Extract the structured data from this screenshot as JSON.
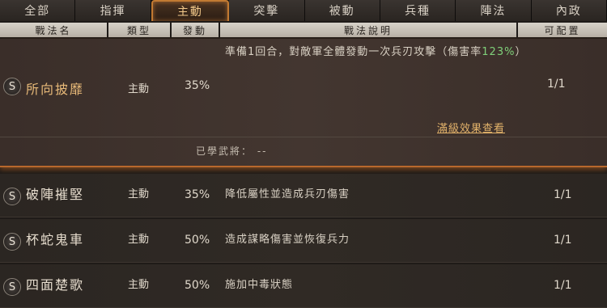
{
  "tabs": [
    "全部",
    "指揮",
    "主動",
    "突擊",
    "被動",
    "兵種",
    "陣法",
    "內政"
  ],
  "active_tab": "主動",
  "columns": [
    "戰法名",
    "類型",
    "發動",
    "戰法說明",
    "可配置"
  ],
  "expanded": {
    "badge": "S",
    "name": "所向披靡",
    "type": "主動",
    "rate": "35%",
    "desc_part1": "準備1回合，對敵軍全體發動一次兵刃攻擊（傷害率",
    "desc_pct": "123%",
    "desc_part2": "）",
    "capacity": "1/1",
    "link": "滿級效果查看",
    "learned_label": "已學武將：",
    "learned_value": "--"
  },
  "rows": [
    {
      "badge": "S",
      "name": "破陣摧堅",
      "type": "主動",
      "rate": "35%",
      "desc": "降低屬性並造成兵刃傷害",
      "capacity": "1/1"
    },
    {
      "badge": "S",
      "name": "杯蛇鬼車",
      "type": "主動",
      "rate": "50%",
      "desc": "造成謀略傷害並恢復兵力",
      "capacity": "1/1"
    },
    {
      "badge": "S",
      "name": "四面楚歌",
      "type": "主動",
      "rate": "50%",
      "desc": "施加中毒狀態",
      "capacity": "1/1"
    }
  ]
}
